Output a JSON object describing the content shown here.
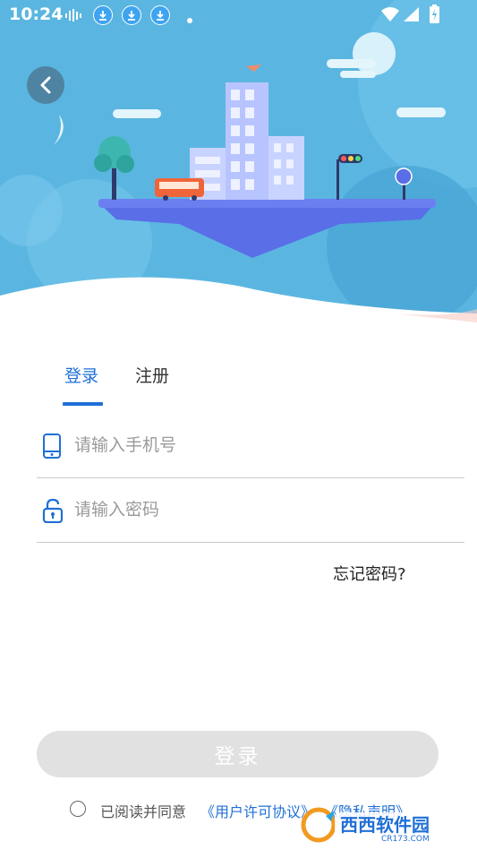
{
  "status_bar": {
    "time": "10:24"
  },
  "tabs": {
    "login": "登录",
    "register": "注册"
  },
  "phone_field": {
    "placeholder": "请输入手机号",
    "value": ""
  },
  "password_field": {
    "placeholder": "请输入密码",
    "value": ""
  },
  "forgot_password": "忘记密码?",
  "login_button": "登录",
  "agreement": {
    "prefix": "已阅读并同意",
    "user_license": "《用户许可协议》",
    "privacy": "《隐私声明》"
  },
  "watermark": {
    "name": "西西软件园",
    "domain": "CR173.COM"
  },
  "colors": {
    "accent": "#1f6fd6",
    "sky": "#5ab6e0",
    "button_disabled": "#e1e1e1"
  }
}
